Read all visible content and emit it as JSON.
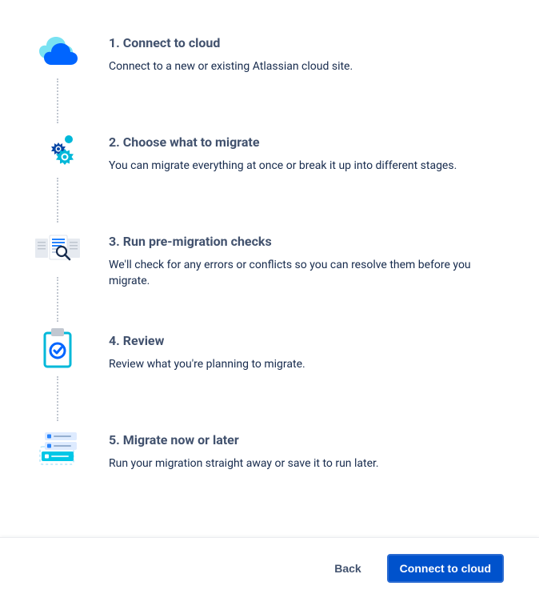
{
  "steps": [
    {
      "title": "1. Connect to cloud",
      "desc": "Connect to a new or existing Atlassian cloud site."
    },
    {
      "title": "2. Choose what to migrate",
      "desc": "You can migrate everything at once or break it up into different stages."
    },
    {
      "title": "3. Run pre-migration checks",
      "desc": "We'll check for any errors or conflicts so you can resolve them before you migrate."
    },
    {
      "title": "4. Review",
      "desc": "Review what you're planning to migrate."
    },
    {
      "title": "5. Migrate now or later",
      "desc": "Run your migration straight away or save it to run later."
    }
  ],
  "footer": {
    "back_label": "Back",
    "connect_label": "Connect to cloud"
  }
}
